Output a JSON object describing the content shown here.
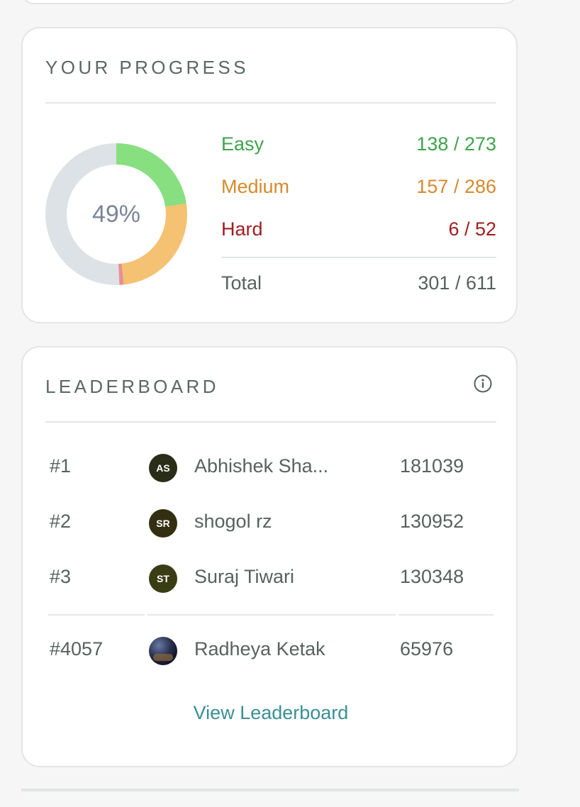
{
  "progress": {
    "title": "YOUR PROGRESS",
    "percent_label": "49%",
    "percent": 49,
    "colors": {
      "easy": "#88df80",
      "medium": "#f4c272",
      "hard": "#e98f92",
      "track": "#dde2e6"
    },
    "easy": {
      "label": "Easy",
      "solved": 138,
      "total": 273,
      "value": "138 / 273"
    },
    "medium": {
      "label": "Medium",
      "solved": 157,
      "total": 286,
      "value": "157 / 286"
    },
    "hard": {
      "label": "Hard",
      "solved": 6,
      "total": 52,
      "value": "6 / 52"
    },
    "overall": {
      "label": "Total",
      "solved": 301,
      "total": 611,
      "value": "301 / 611"
    }
  },
  "leaderboard": {
    "title": "LEADERBOARD",
    "info_icon": "info-icon",
    "entries": [
      {
        "rank": "#1",
        "initials": "AS",
        "name": "Abhishek Sha...",
        "score": "181039",
        "avatar_color": "#2a2d18"
      },
      {
        "rank": "#2",
        "initials": "SR",
        "name": "shogol rz",
        "score": "130952",
        "avatar_color": "#332f12"
      },
      {
        "rank": "#3",
        "initials": "ST",
        "name": "Suraj Tiwari",
        "score": "130348",
        "avatar_color": "#3a3d14"
      }
    ],
    "current_user": {
      "rank": "#4057",
      "name": "Radheya Ketak",
      "score": "65976",
      "avatar": "photo-avatar"
    },
    "view_link": "View Leaderboard"
  }
}
